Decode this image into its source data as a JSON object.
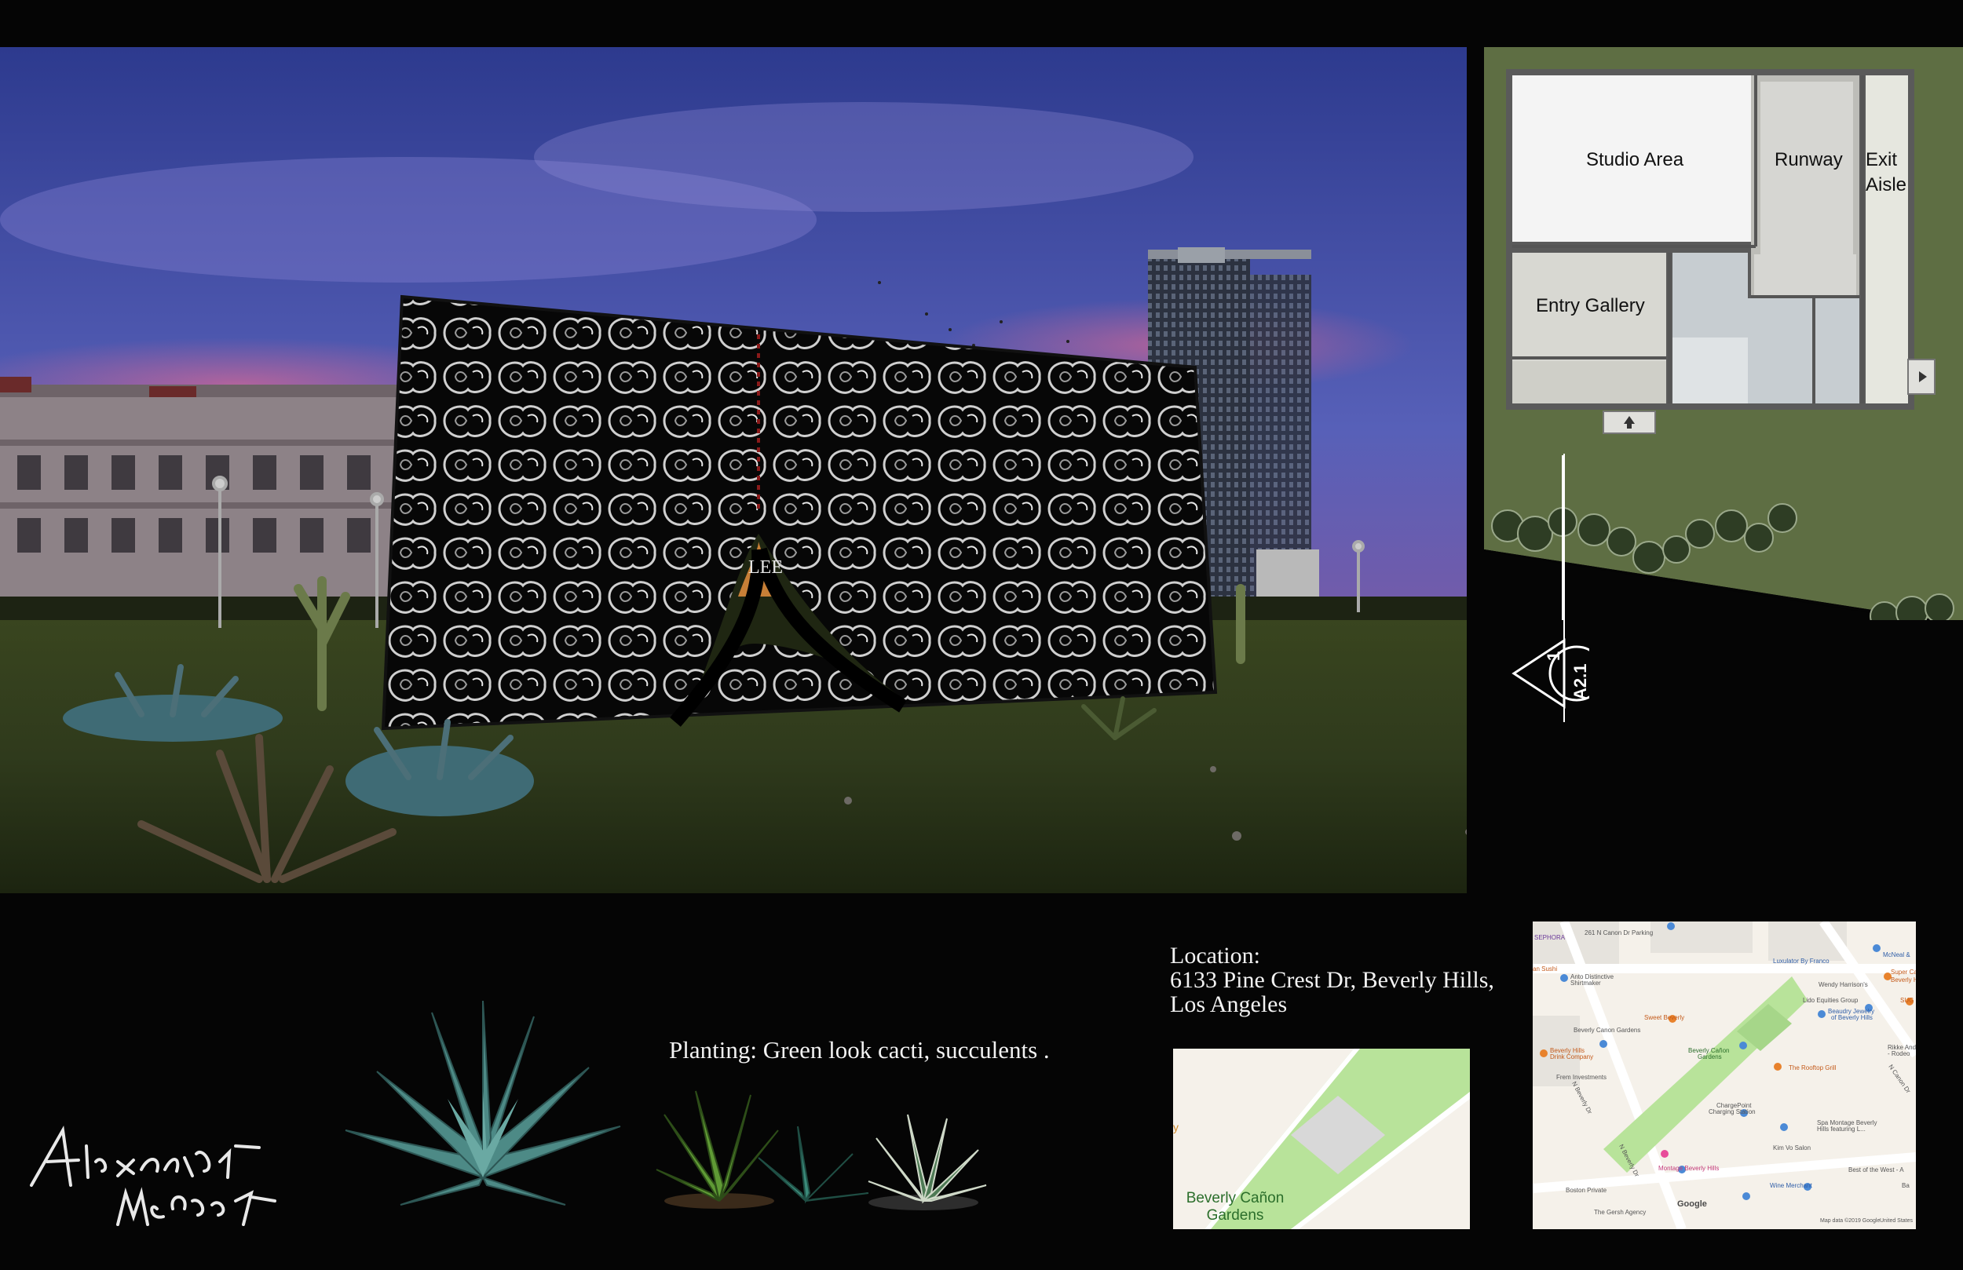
{
  "render": {
    "sign_text": "LEE"
  },
  "floor_plan": {
    "rooms": {
      "studio": "Studio Area",
      "runway": "Runway",
      "exit_line1": "Exit",
      "exit_line2": "Aisle",
      "entry": "Entry Gallery"
    },
    "section_marker": {
      "number": "1",
      "sheet": "A2.1"
    }
  },
  "location": {
    "heading": "Location:",
    "line1": "6133 Pine Crest Dr, Beverly Hills,",
    "line2": "Los Angeles"
  },
  "planting": {
    "caption": "Planting: Green look cacti, succulents ."
  },
  "signature": "Alexander McQueen",
  "map_small": {
    "label_line1": "Beverly Cañon",
    "label_line2": "Gardens"
  },
  "map_large": {
    "labels": {
      "sephora": "SEPHORA",
      "canon_parking": "261 N Canon Dr Parking",
      "mcneal": "McNeal &",
      "luxulator": "Luxulator By Franco",
      "super_car": "Super Car",
      "beverly_hi": "Beverly Hi",
      "wendy": "Wendy Harrison's",
      "sushi": "an Sushi",
      "anto1": "Anto Distinctive",
      "anto2": "Shirtmaker",
      "lido": "Lido Equities Group",
      "sug": "SUG",
      "beaudry1": "Beaudry Jewelry",
      "beaudry2": "of Beverly Hills",
      "sweet": "Sweet Beverly",
      "canon_gardens": "Beverly Canon Gardens",
      "bh_drink1": "Beverly Hills",
      "bh_drink2": "Drink Company",
      "bc_gardens1": "Beverly Cañon",
      "bc_gardens2": "Gardens",
      "rikke1": "Rikke And",
      "rikke2": "- Rodeo",
      "rooftop": "The Rooftop Grill",
      "frem": "Frem Investments",
      "n_canon": "N Canon Dr",
      "n_beverly": "N Beverly Dr",
      "charge1": "ChargePoint",
      "charge2": "Charging Station",
      "spa1": "Spa Montage Beverly",
      "spa2": "Hills featuring L...",
      "kim": "Kim Vo Salon",
      "montage": "Montage Beverly Hills",
      "best_west": "Best of the West - A",
      "boston": "Boston Private",
      "wine": "Wine Merchant",
      "n_beverly2": "N Beverly Dr",
      "gersh": "The Gersh Agency",
      "google": "Google",
      "map_data": "Map data ©2019 Google",
      "united_states": "United States",
      "ba": "Ba"
    }
  },
  "colors": {
    "background": "#050505",
    "lawn_plan": "#5e6e43",
    "map_land": "#f5f1ea",
    "map_park": "#b8e39a"
  }
}
